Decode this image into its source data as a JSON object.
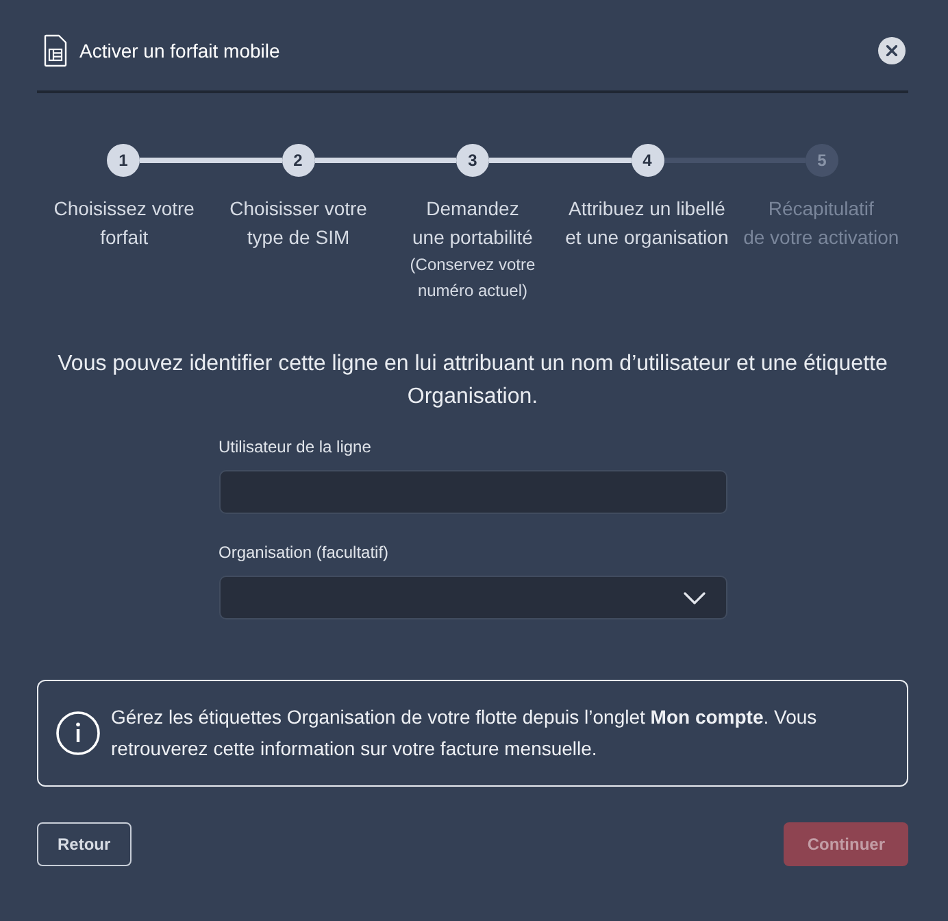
{
  "dialog": {
    "title": "Activer un forfait mobile"
  },
  "steps": [
    {
      "number": "1",
      "label": "Choisissez votre\nforfait",
      "reached": true
    },
    {
      "number": "2",
      "label": "Choisisser votre\ntype de SIM",
      "reached": true
    },
    {
      "number": "3",
      "label": "Demandez\nune portabilité",
      "note": "(Conservez votre\nnuméro actuel)",
      "reached": true
    },
    {
      "number": "4",
      "label": "Attribuez un libellé\net une organisation",
      "reached": true
    },
    {
      "number": "5",
      "label": "Récapitulatif\nde votre activation",
      "reached": false
    }
  ],
  "description": "Vous pouvez identifier cette ligne en lui attribuant un nom d’utilisateur et une étiquette Organisation.",
  "fields": [
    {
      "kind": "text",
      "label": "Utilisateur de la ligne"
    },
    {
      "kind": "select",
      "label": "Organisation (facultatif)"
    }
  ],
  "info": {
    "text": "Gérez les étiquettes Organisation de votre flotte depuis l’onglet **Mon compte**. Vous retrouverez cette information sur votre facture mensuelle."
  },
  "buttons": [
    {
      "label": "Retour",
      "kind": "secondary",
      "disabled": false
    },
    {
      "label": "Continuer",
      "kind": "primary",
      "disabled": true
    }
  ]
}
